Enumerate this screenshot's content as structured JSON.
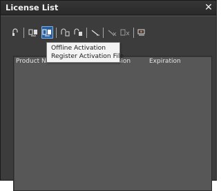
{
  "window": {
    "title": "License List",
    "close_symbol": "✕"
  },
  "toolbar": {
    "buttons": [
      {
        "icon": "license-icon",
        "state": "normal"
      },
      {
        "icon": "online-activation-icon",
        "state": "normal"
      },
      {
        "icon": "offline-activation-icon",
        "state": "active"
      },
      {
        "icon": "deactivate-icon",
        "state": "normal"
      },
      {
        "icon": "offline-deactivate-icon",
        "state": "normal"
      },
      {
        "icon": "repair-icon",
        "state": "normal"
      },
      {
        "icon": "remove-icon",
        "state": "disabled"
      },
      {
        "icon": "remove-all-icon",
        "state": "disabled"
      },
      {
        "icon": "settings-icon",
        "state": "normal"
      }
    ]
  },
  "list": {
    "columns": [
      "Product Name",
      "Version",
      "Expiration"
    ]
  },
  "dropdown_menu": {
    "items": [
      "Offline Activation",
      "Register Activation File"
    ]
  },
  "colors": {
    "background": "#3c3c3c",
    "list_background": "#575757",
    "active_button": "#2a5f9c",
    "menu_background": "#f3f3f3"
  }
}
